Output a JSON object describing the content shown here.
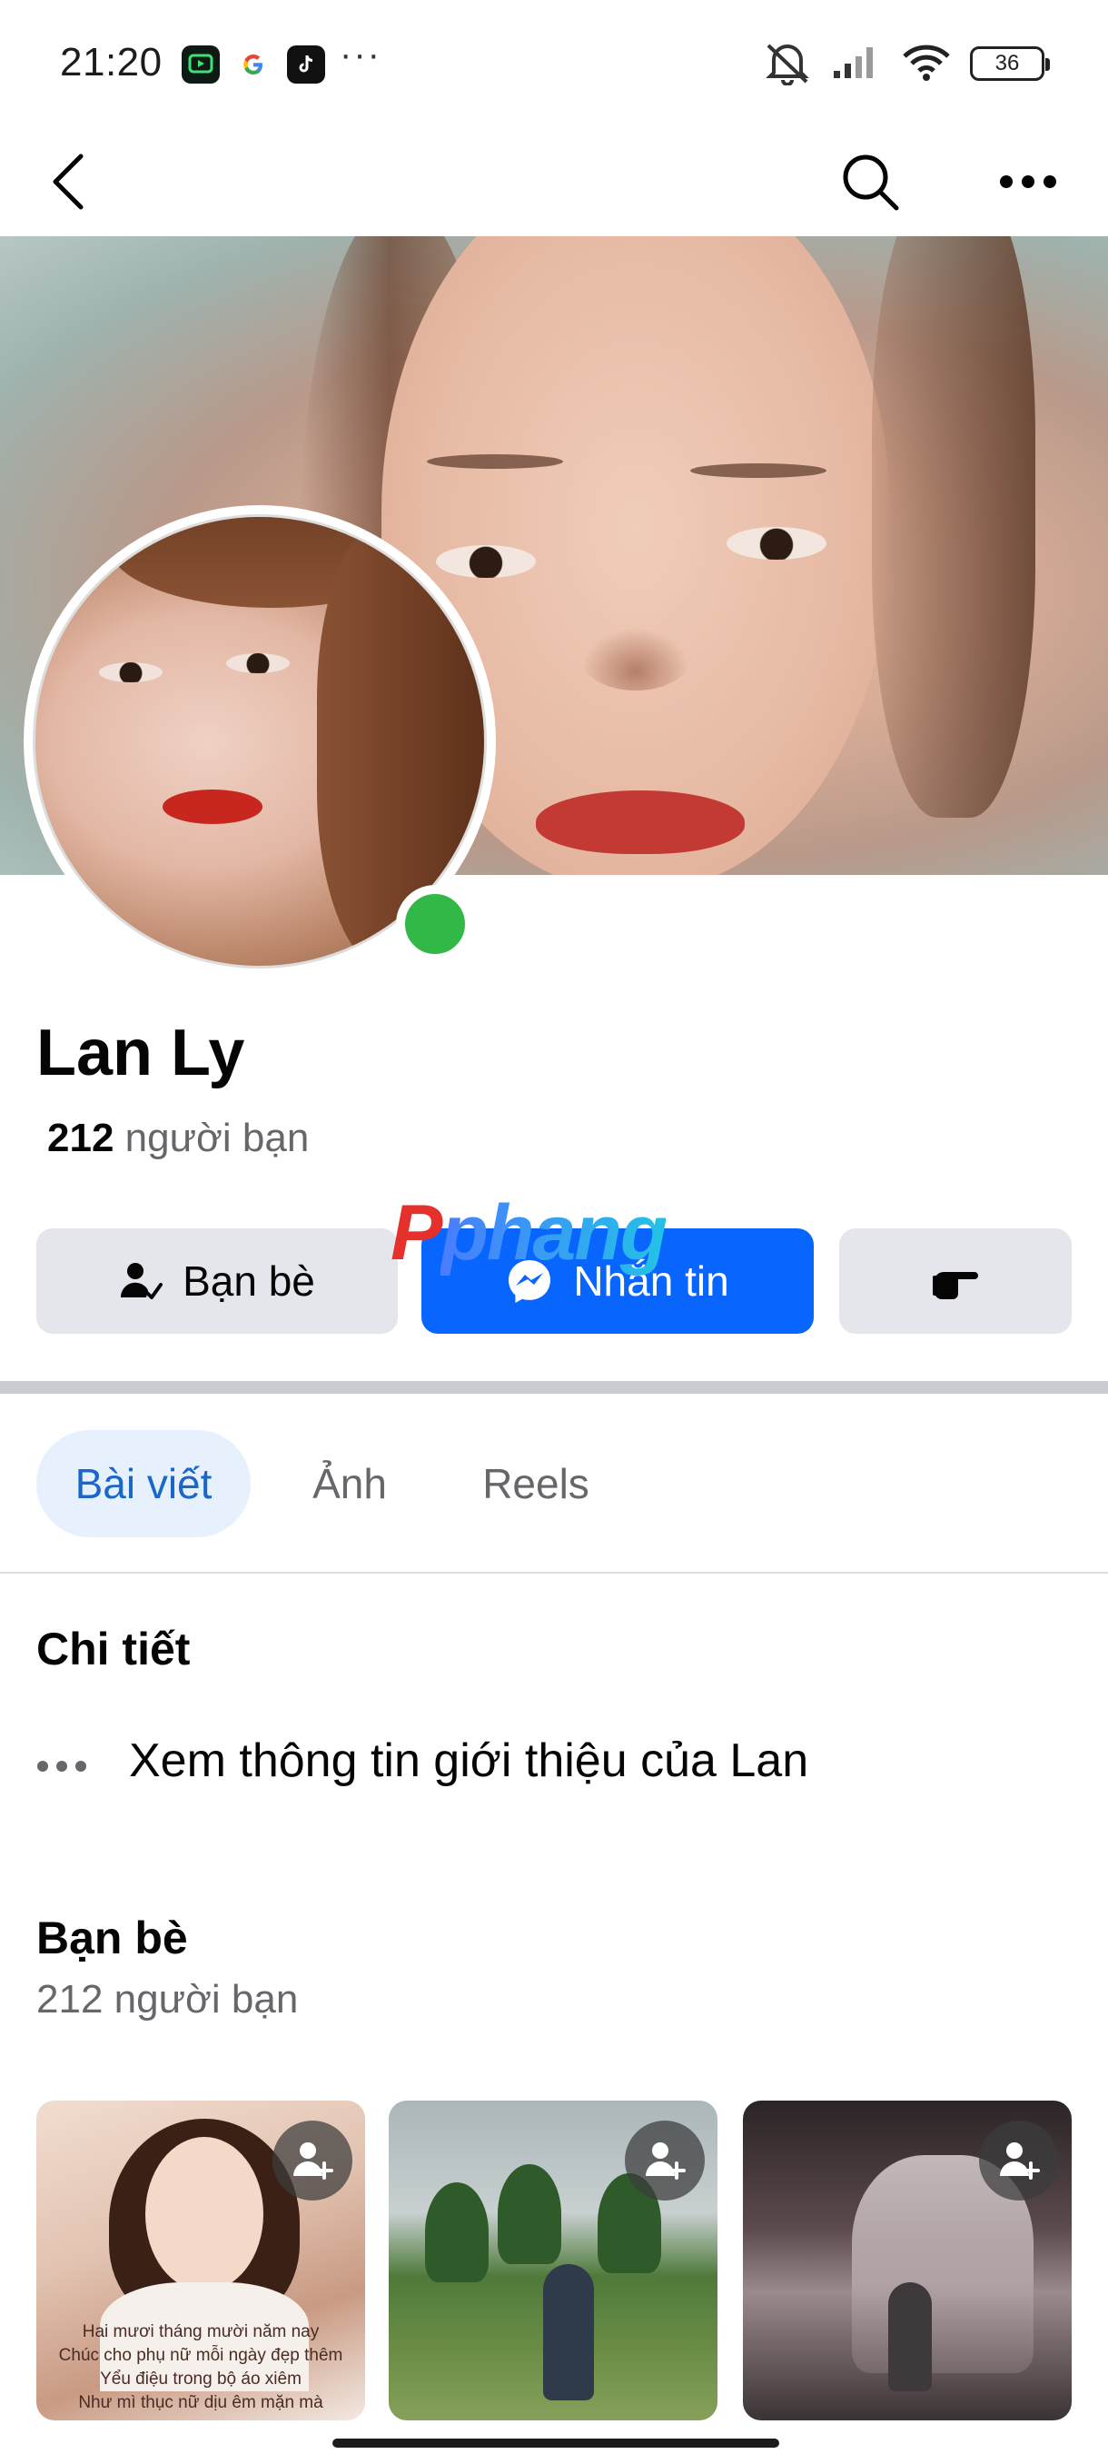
{
  "status_bar": {
    "time": "21:20",
    "app_icons": [
      "tv-app-icon",
      "google-icon",
      "tiktok-icon"
    ],
    "more": "···",
    "battery": "36"
  },
  "top_nav": {
    "back_icon": "chevron-left-icon",
    "search_icon": "search-icon",
    "more_icon": "ellipsis-icon"
  },
  "profile": {
    "name": "Lan Ly",
    "friend_count_number": "212",
    "friend_count_label": "người bạn",
    "online": true
  },
  "actions": {
    "friends_label": "Bạn bè",
    "message_label": "Nhắn tin",
    "more_icon": "poke-hand-icon"
  },
  "watermark": {
    "first": "P",
    "rest": "phang"
  },
  "tabs": [
    {
      "label": "Bài viết",
      "active": true
    },
    {
      "label": "Ảnh",
      "active": false
    },
    {
      "label": "Reels",
      "active": false
    }
  ],
  "details": {
    "title": "Chi tiết",
    "intro_text": "Xem thông tin giới thiệu của Lan"
  },
  "friends": {
    "title": "Bạn bè",
    "subtitle": "212 người bạn",
    "cards": [
      {
        "caption_lines": [
          "Hai mươi tháng mười năm nay",
          "Chúc cho phụ nữ mỗi ngày đẹp thêm",
          "Yểu điệu trong bộ áo xiêm",
          "Như mì thục nữ dịu êm mặn mà"
        ]
      },
      {
        "caption_lines": []
      },
      {
        "caption_lines": []
      }
    ]
  },
  "colors": {
    "accent": "#0866ff",
    "online": "#31b847",
    "tab_active_bg": "#e7f1fd",
    "tab_active_text": "#1b66c9",
    "button_bg": "#e4e6eb"
  }
}
